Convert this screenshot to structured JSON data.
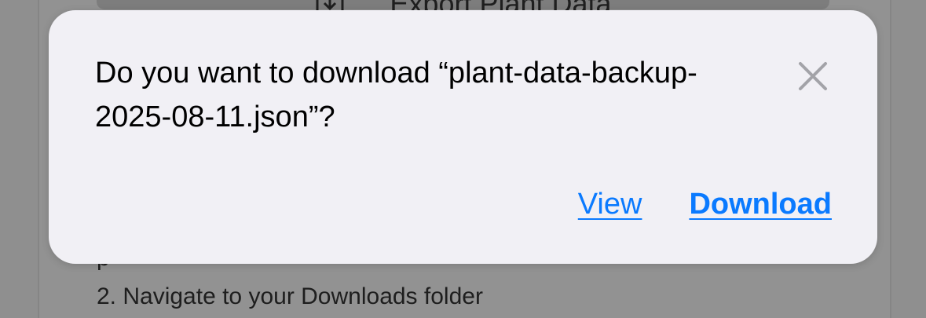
{
  "background": {
    "export_button_label": "Export Plant Data",
    "step_partial": "p",
    "step_2": "2. Navigate to your Downloads folder"
  },
  "dialog": {
    "message": "Do you want to download “plant-data-backup-2025-08-11.json”?",
    "close_icon": "close-icon",
    "view_label": "View",
    "download_label": "Download"
  },
  "colors": {
    "accent": "#0a7aff",
    "dialog_bg": "#f1f0f5",
    "backdrop": "#8f8f8f"
  }
}
